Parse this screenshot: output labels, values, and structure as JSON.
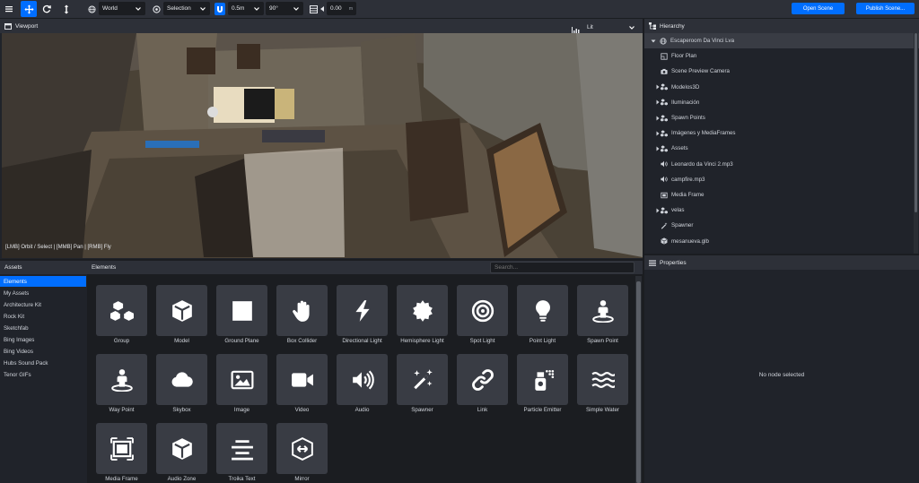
{
  "toolbar": {
    "transform_space": "World",
    "pivot_mode": "Selection",
    "snap_translate": "0.5m",
    "snap_rotate": "90°",
    "grid_height": "0.00",
    "grid_unit": "m",
    "open_scene_label": "Open Scene",
    "publish_label": "Publish Scene..."
  },
  "viewport": {
    "title": "Viewport",
    "shading_mode": "Lit",
    "controls_hint": "[LMB] Orbit / Select | [MMB] Pan | [RMB] Fly"
  },
  "hierarchy": {
    "title": "Hierarchy",
    "items": [
      {
        "label": "Escaperoom Da Vinci Lva",
        "icon": "globe-icon"
      },
      {
        "label": "Floor Plan",
        "icon": "floorplan-icon"
      },
      {
        "label": "Scene Preview Camera",
        "icon": "camera-icon"
      },
      {
        "label": "Modelos3D",
        "icon": "group-icon"
      },
      {
        "label": "Iluminación",
        "icon": "group-icon"
      },
      {
        "label": "Spawn Points",
        "icon": "group-icon"
      },
      {
        "label": "Imágenes y MediaFrames",
        "icon": "group-icon"
      },
      {
        "label": "Assets",
        "icon": "group-icon"
      },
      {
        "label": "Leonardo da Vinci 2.mp3",
        "icon": "audio-icon"
      },
      {
        "label": "campfire.mp3",
        "icon": "audio-icon"
      },
      {
        "label": "Media Frame",
        "icon": "media-frame-icon"
      },
      {
        "label": "velas",
        "icon": "group-icon"
      },
      {
        "label": "Spawner",
        "icon": "spawner-icon"
      },
      {
        "label": "mesanueva.glb",
        "icon": "model-icon"
      }
    ]
  },
  "properties": {
    "title": "Properties",
    "empty_text": "No node selected"
  },
  "assets": {
    "title": "Assets",
    "items": [
      "Elements",
      "My Assets",
      "Architecture Kit",
      "Rock Kit",
      "Sketchfab",
      "Bing Images",
      "Bing Videos",
      "Hubs Sound Pack",
      "Tenor GIFs"
    ]
  },
  "elements": {
    "title": "Elements",
    "search_placeholder": "Search...",
    "items": [
      {
        "label": "Group",
        "icon": "group-icon"
      },
      {
        "label": "Model",
        "icon": "cube-icon"
      },
      {
        "label": "Ground Plane",
        "icon": "square-icon"
      },
      {
        "label": "Box Collider",
        "icon": "hand-icon"
      },
      {
        "label": "Directional Light",
        "icon": "bolt-icon"
      },
      {
        "label": "Hemisphere Light",
        "icon": "certificate-icon"
      },
      {
        "label": "Spot Light",
        "icon": "bullseye-icon"
      },
      {
        "label": "Point Light",
        "icon": "lightbulb-icon"
      },
      {
        "label": "Spawn Point",
        "icon": "street-view-icon"
      },
      {
        "label": "Way Point",
        "icon": "street-view-icon"
      },
      {
        "label": "Skybox",
        "icon": "cloud-icon"
      },
      {
        "label": "Image",
        "icon": "image-icon"
      },
      {
        "label": "Video",
        "icon": "video-icon"
      },
      {
        "label": "Audio",
        "icon": "volume-icon"
      },
      {
        "label": "Spawner",
        "icon": "magic-icon"
      },
      {
        "label": "Link",
        "icon": "link-icon"
      },
      {
        "label": "Particle Emitter",
        "icon": "spray-can-icon"
      },
      {
        "label": "Simple Water",
        "icon": "water-icon"
      },
      {
        "label": "Media Frame",
        "icon": "media-frame-icon"
      },
      {
        "label": "Audio Zone",
        "icon": "cube-icon"
      },
      {
        "label": "Troika Text",
        "icon": "align-center-icon"
      },
      {
        "label": "Mirror",
        "icon": "mirror-icon"
      }
    ]
  },
  "colors": {
    "accent": "#006eff",
    "panel": "#20232a",
    "toolbar": "#2d3038",
    "tile": "#393c44"
  }
}
